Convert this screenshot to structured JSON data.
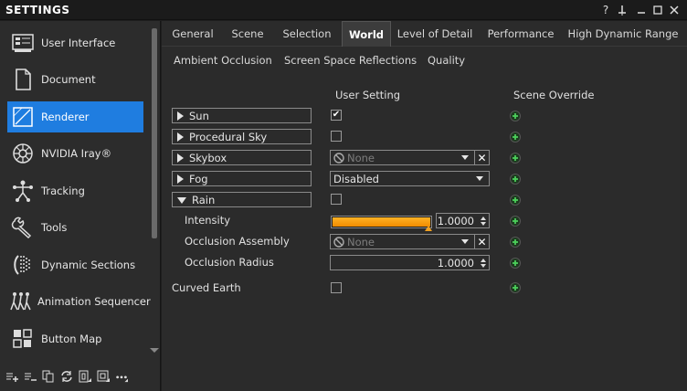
{
  "window": {
    "title": "SETTINGS",
    "controls": [
      "?",
      "⊥",
      "─",
      "□",
      "✕"
    ]
  },
  "sidebar": {
    "items": [
      {
        "label": "User Interface",
        "icon": "user-interface-icon"
      },
      {
        "label": "Document",
        "icon": "document-icon"
      },
      {
        "label": "Renderer",
        "icon": "renderer-icon",
        "active": true
      },
      {
        "label": "NVIDIA Iray®",
        "icon": "nvidia-iray-icon"
      },
      {
        "label": "Tracking",
        "icon": "tracking-icon"
      },
      {
        "label": "Tools",
        "icon": "tools-icon"
      },
      {
        "label": "Dynamic Sections",
        "icon": "dynamic-sections-icon"
      },
      {
        "label": "Animation Sequencer",
        "icon": "animation-sequencer-icon"
      },
      {
        "label": "Button Map",
        "icon": "button-map-icon"
      }
    ],
    "toolbar": [
      "add-icon",
      "remove-icon",
      "copy-icon",
      "refresh-icon",
      "import-icon",
      "export-icon",
      "more-icon"
    ]
  },
  "tabs": {
    "primary": [
      "General",
      "Scene",
      "Selection",
      "World",
      "Level of Detail",
      "Performance",
      "High Dynamic Range"
    ],
    "active": "World",
    "secondary": [
      "Ambient Occlusion",
      "Screen Space Reflections",
      "Quality"
    ]
  },
  "columns": {
    "user_setting": "User Setting",
    "scene_override": "Scene Override"
  },
  "rows": {
    "sun": {
      "label": "Sun",
      "checked": true
    },
    "procedural_sky": {
      "label": "Procedural Sky",
      "checked": false
    },
    "skybox": {
      "label": "Skybox",
      "value": "None"
    },
    "fog": {
      "label": "Fog",
      "value": "Disabled"
    },
    "rain": {
      "label": "Rain",
      "checked": false
    },
    "intensity": {
      "label": "Intensity",
      "value": "1.0000",
      "level": 1.0
    },
    "occlusion_assembly": {
      "label": "Occlusion Assembly",
      "value": "None"
    },
    "occlusion_radius": {
      "label": "Occlusion Radius",
      "value": "1.0000"
    },
    "curved_earth": {
      "label": "Curved Earth",
      "checked": false
    }
  },
  "colors": {
    "accent": "#1f7de0",
    "slider_fill": "#f5a00f",
    "override_icon": "#3fb04a"
  }
}
